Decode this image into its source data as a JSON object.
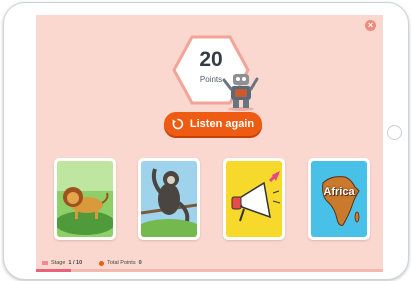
{
  "score": {
    "value": "20",
    "label": "Points"
  },
  "listen_button": {
    "label": "Listen again",
    "icon": "replay-icon"
  },
  "cards": [
    {
      "name": "lion",
      "label": ""
    },
    {
      "name": "gibbon",
      "label": ""
    },
    {
      "name": "megaphone",
      "label": ""
    },
    {
      "name": "africa-map",
      "label": "Africa"
    }
  ],
  "status": {
    "stage_label": "Stage",
    "stage_value": "1 / 10",
    "points_label": "Total Points",
    "points_value": "0"
  },
  "progress": {
    "fraction": 0.1
  },
  "colors": {
    "screen_bg": "#fbd8cf",
    "accent": "#ee5b12",
    "close": "#f08a7e",
    "progress_fill": "#e9617b"
  },
  "close_icon": "close-icon"
}
